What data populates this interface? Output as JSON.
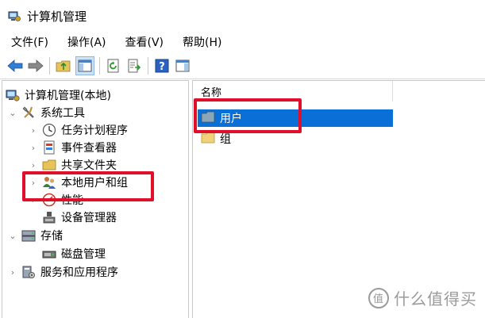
{
  "window": {
    "title": "计算机管理"
  },
  "menu": [
    "文件(F)",
    "操作(A)",
    "查看(V)",
    "帮助(H)"
  ],
  "toolbar": {
    "buttons": [
      "back-icon",
      "forward-icon",
      "up-folder-icon",
      "show-hide-tree-icon",
      "refresh-icon",
      "export-list-icon",
      "help-icon",
      "show-hide-action-pane-icon"
    ]
  },
  "tree": {
    "root": "计算机管理(本地)",
    "system_tools": "系统工具",
    "task_scheduler": "任务计划程序",
    "event_viewer": "事件查看器",
    "shared_folders": "共享文件夹",
    "local_users_groups": "本地用户和组",
    "performance": "性能",
    "device_manager": "设备管理器",
    "storage": "存储",
    "disk_management": "磁盘管理",
    "services_apps": "服务和应用程序"
  },
  "list": {
    "column_name": "名称",
    "items": [
      "用户",
      "组"
    ],
    "selected": "用户"
  },
  "colors": {
    "highlight": "#e0102a",
    "selection": "#0a6fd6"
  },
  "watermark": {
    "logo": "值",
    "text": "什么值得买"
  }
}
